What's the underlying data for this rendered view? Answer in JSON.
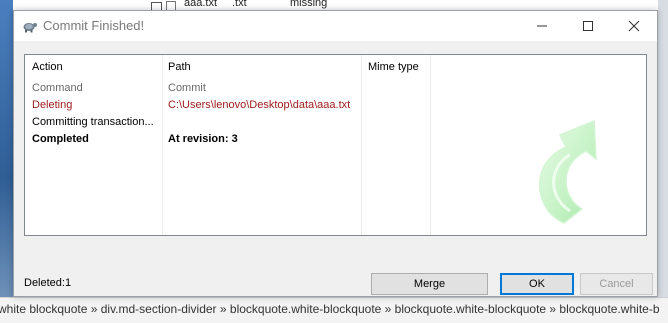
{
  "background": {
    "row_text_1": "aaa.txt",
    "row_text_2": ".txt",
    "row_text_3": "missing",
    "breadcrumb": "white blockquote » div.md-section-divider » blockquote.white-blockquote » blockquote.white-blockquote » blockquote.white-b"
  },
  "window": {
    "title": "Commit Finished!",
    "icons": {
      "app": "tortoise-icon",
      "minimize": "minimize-icon",
      "maximize": "maximize-icon",
      "close": "close-icon"
    }
  },
  "columns": {
    "action": "Action",
    "path": "Path",
    "mime": "Mime type"
  },
  "rows": [
    {
      "action": "Command",
      "path": "Commit",
      "mime": ""
    },
    {
      "action": "Deleting",
      "path": "C:\\Users\\lenovo\\Desktop\\data\\aaa.txt",
      "mime": ""
    },
    {
      "action": "Committing transaction...",
      "path": "",
      "mime": ""
    },
    {
      "action": "Completed",
      "path": "At revision: 3",
      "mime": ""
    }
  ],
  "status": "Deleted:1",
  "buttons": {
    "merge": "Merge",
    "ok": "OK",
    "cancel": "Cancel"
  },
  "colors": {
    "command_gray": "#6a6a6a",
    "deleting_red": "#9b1a1a",
    "accent_blue": "#0078d7",
    "arrow_green": "#b8f0b8"
  }
}
